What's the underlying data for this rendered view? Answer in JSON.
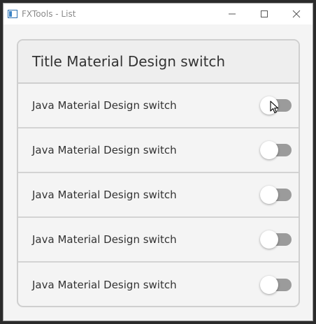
{
  "window": {
    "title": "FXTools - List"
  },
  "card": {
    "title": "Title Material Design switch",
    "rows": [
      {
        "label": "Java Material Design switch",
        "switch_on": false
      },
      {
        "label": "Java Material Design switch",
        "switch_on": false
      },
      {
        "label": "Java Material Design switch",
        "switch_on": false
      },
      {
        "label": "Java Material Design switch",
        "switch_on": false
      },
      {
        "label": "Java Material Design switch",
        "switch_on": false
      }
    ]
  },
  "icons": {
    "app": "app-window-icon",
    "minimize": "minimize-icon",
    "maximize": "maximize-icon",
    "close": "close-icon",
    "cursor": "mouse-cursor-icon"
  },
  "colors": {
    "track_off": "#9b9b9b",
    "thumb": "#ffffff",
    "card_border": "#cfcfcf",
    "header_bg": "#eeeeee"
  }
}
